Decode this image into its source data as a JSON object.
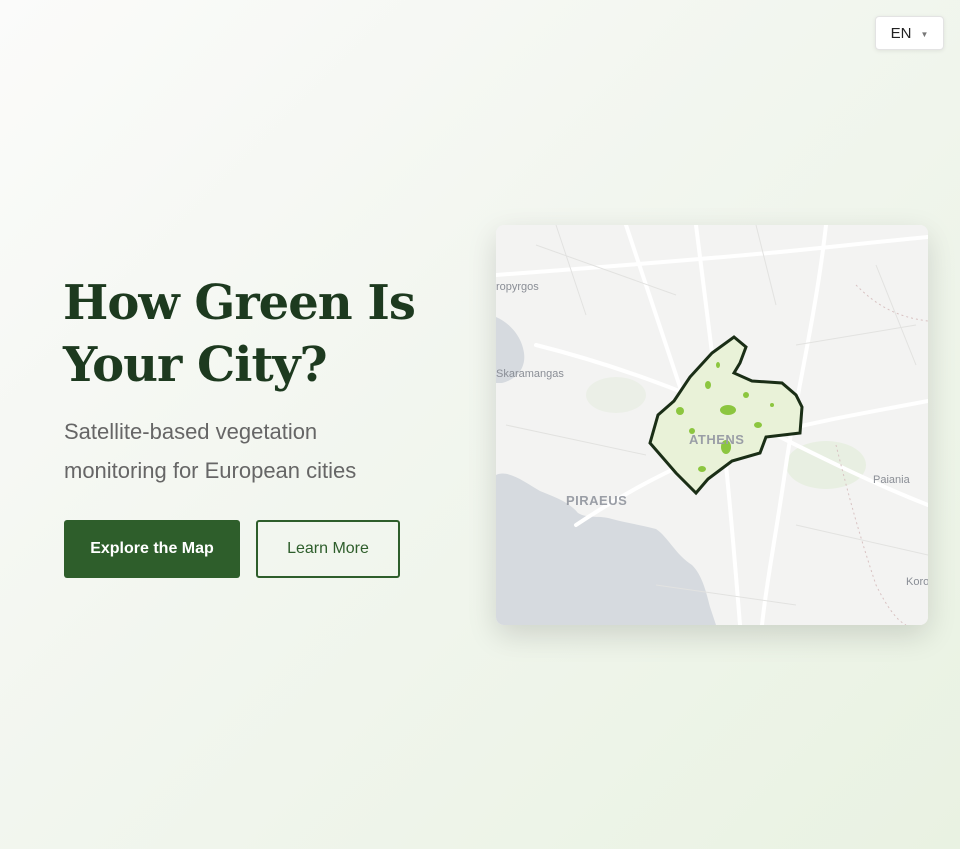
{
  "language_selector": {
    "value": "EN",
    "caret_icon": "caret-down-icon"
  },
  "hero": {
    "title": "How Green Is Your City?",
    "subtitle": "Satellite-based vegetation monitoring for European cities",
    "primary_button": "Explore the Map",
    "secondary_button": "Learn More"
  },
  "map": {
    "labels": {
      "aspropyrgos": "ropyrgos",
      "skaramangas": "Skaramangas",
      "piraeus": "PIRAEUS",
      "athens": "ATHENS",
      "paiania": "Paiania",
      "koropi": "Koro"
    },
    "colors": {
      "sea": "#d6dadf",
      "land": "#f3f3f2",
      "vegetation": "#8cc63f",
      "boundary": "#1a2e16"
    }
  },
  "colors": {
    "accent": "#2e5e2b",
    "title": "#1d3a1f",
    "subtitle": "#666666"
  }
}
